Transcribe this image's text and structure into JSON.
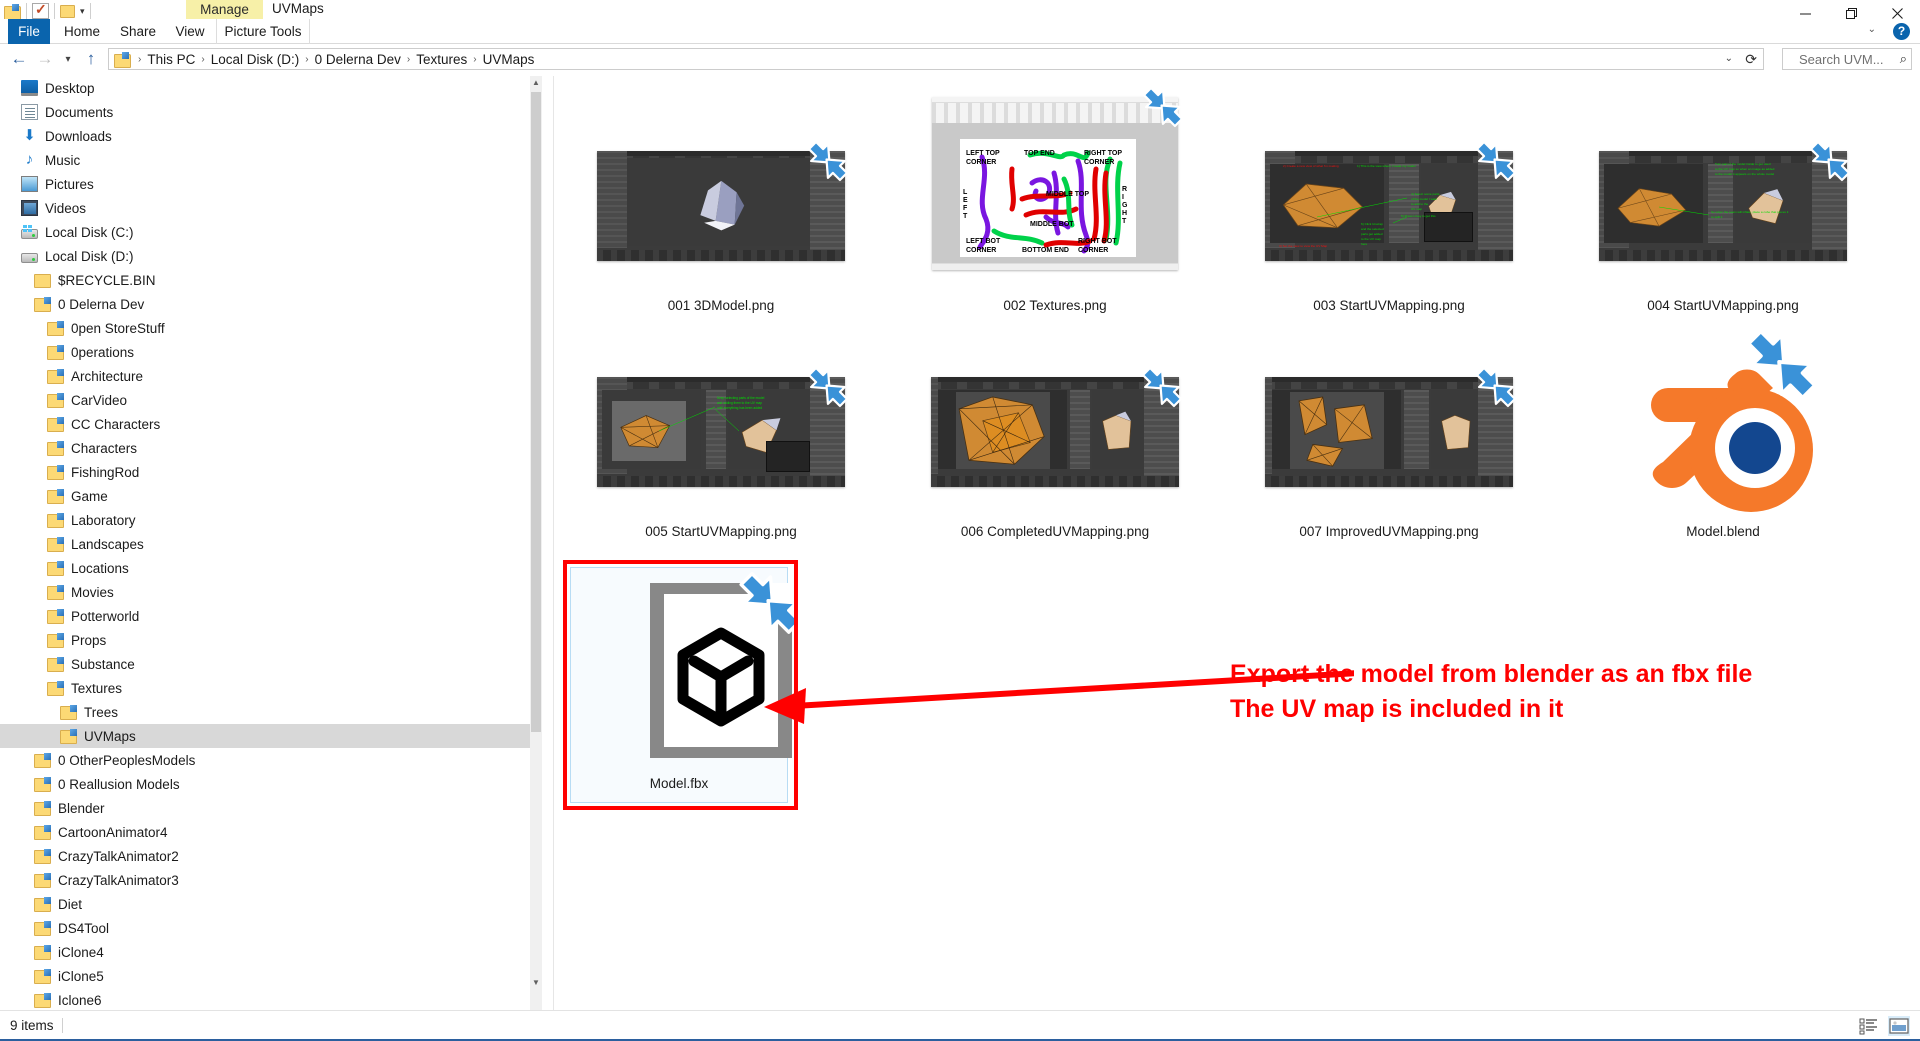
{
  "window": {
    "title": "UVMaps",
    "contextual_tab_group": "Manage",
    "contextual_tab": "Picture Tools",
    "minimize_label": "Minimize",
    "maximize_label": "Maximize",
    "close_label": "Close",
    "help_label": "?",
    "ribbon_collapse_label": "Collapse the Ribbon"
  },
  "quick_access": {
    "items": [
      {
        "name": "folder-properties-icon",
        "label": ""
      },
      {
        "name": "check-document-icon",
        "label": ""
      },
      {
        "name": "new-folder-icon",
        "label": ""
      },
      {
        "name": "customize-quick-access-chevron",
        "label": ""
      }
    ]
  },
  "ribbon": {
    "tabs": [
      {
        "id": "file",
        "label": "File"
      },
      {
        "id": "home",
        "label": "Home"
      },
      {
        "id": "share",
        "label": "Share"
      },
      {
        "id": "view",
        "label": "View"
      },
      {
        "id": "picture-tools",
        "label": "Picture Tools"
      }
    ]
  },
  "address": {
    "back_label": "Back",
    "forward_label": "Forward",
    "recent_label": "Recent locations",
    "up_label": "Up",
    "crumbs": [
      "This PC",
      "Local Disk (D:)",
      "0 Delerna Dev",
      "Textures",
      "UVMaps"
    ],
    "separator": "›",
    "dropdown_label": "Previous locations",
    "refresh_label": "Refresh"
  },
  "search": {
    "placeholder": "Search UVM...",
    "icon": "search-icon"
  },
  "nav_pane": {
    "items": [
      {
        "label": "Desktop",
        "icon": "desktop-icon",
        "indent": 1,
        "selected": false
      },
      {
        "label": "Documents",
        "icon": "documents-icon",
        "indent": 1,
        "selected": false
      },
      {
        "label": "Downloads",
        "icon": "downloads-icon",
        "indent": 1,
        "selected": false
      },
      {
        "label": "Music",
        "icon": "music-icon",
        "indent": 1,
        "selected": false
      },
      {
        "label": "Pictures",
        "icon": "pictures-icon",
        "indent": 1,
        "selected": false
      },
      {
        "label": "Videos",
        "icon": "videos-icon",
        "indent": 1,
        "selected": false
      },
      {
        "label": "Local Disk (C:)",
        "icon": "drive-windows-icon",
        "indent": 1,
        "selected": false
      },
      {
        "label": "Local Disk (D:)",
        "icon": "drive-icon",
        "indent": 1,
        "selected": false
      },
      {
        "label": "$RECYCLE.BIN",
        "icon": "folder-icon",
        "indent": 2,
        "selected": false
      },
      {
        "label": "0 Delerna Dev",
        "icon": "folder-shared-icon",
        "indent": 2,
        "selected": false
      },
      {
        "label": "0pen StoreStuff",
        "icon": "folder-shared-icon",
        "indent": 3,
        "selected": false
      },
      {
        "label": "0perations",
        "icon": "folder-shared-icon",
        "indent": 3,
        "selected": false
      },
      {
        "label": "Architecture",
        "icon": "folder-shared-icon",
        "indent": 3,
        "selected": false
      },
      {
        "label": "CarVideo",
        "icon": "folder-shared-icon",
        "indent": 3,
        "selected": false
      },
      {
        "label": "CC Characters",
        "icon": "folder-shared-icon",
        "indent": 3,
        "selected": false
      },
      {
        "label": "Characters",
        "icon": "folder-shared-icon",
        "indent": 3,
        "selected": false
      },
      {
        "label": "FishingRod",
        "icon": "folder-shared-icon",
        "indent": 3,
        "selected": false
      },
      {
        "label": "Game",
        "icon": "folder-shared-icon",
        "indent": 3,
        "selected": false
      },
      {
        "label": "Laboratory",
        "icon": "folder-shared-icon",
        "indent": 3,
        "selected": false
      },
      {
        "label": "Landscapes",
        "icon": "folder-shared-icon",
        "indent": 3,
        "selected": false
      },
      {
        "label": "Locations",
        "icon": "folder-shared-icon",
        "indent": 3,
        "selected": false
      },
      {
        "label": "Movies",
        "icon": "folder-shared-icon",
        "indent": 3,
        "selected": false
      },
      {
        "label": "Potterworld",
        "icon": "folder-shared-icon",
        "indent": 3,
        "selected": false
      },
      {
        "label": "Props",
        "icon": "folder-shared-icon",
        "indent": 3,
        "selected": false
      },
      {
        "label": "Substance",
        "icon": "folder-shared-icon",
        "indent": 3,
        "selected": false
      },
      {
        "label": "Textures",
        "icon": "folder-shared-icon",
        "indent": 3,
        "selected": false
      },
      {
        "label": "Trees",
        "icon": "folder-shared-icon",
        "indent": 4,
        "selected": false
      },
      {
        "label": "UVMaps",
        "icon": "folder-shared-icon",
        "indent": 4,
        "selected": true
      },
      {
        "label": "0 OtherPeoplesModels",
        "icon": "folder-shared-icon",
        "indent": 2,
        "selected": false
      },
      {
        "label": "0 Reallusion Models",
        "icon": "folder-shared-icon",
        "indent": 2,
        "selected": false
      },
      {
        "label": "Blender",
        "icon": "folder-shared-icon",
        "indent": 2,
        "selected": false
      },
      {
        "label": "CartoonAnimator4",
        "icon": "folder-shared-icon",
        "indent": 2,
        "selected": false
      },
      {
        "label": "CrazyTalkAnimator2",
        "icon": "folder-shared-icon",
        "indent": 2,
        "selected": false
      },
      {
        "label": "CrazyTalkAnimator3",
        "icon": "folder-shared-icon",
        "indent": 2,
        "selected": false
      },
      {
        "label": "Diet",
        "icon": "folder-shared-icon",
        "indent": 2,
        "selected": false
      },
      {
        "label": "DS4Tool",
        "icon": "folder-shared-icon",
        "indent": 2,
        "selected": false
      },
      {
        "label": "iClone4",
        "icon": "folder-shared-icon",
        "indent": 2,
        "selected": false
      },
      {
        "label": "iClone5",
        "icon": "folder-shared-icon",
        "indent": 2,
        "selected": false
      },
      {
        "label": "Iclone6",
        "icon": "folder-shared-icon",
        "indent": 2,
        "selected": false
      }
    ]
  },
  "files": [
    {
      "name": "001 3DModel.png",
      "kind": "blender-viewport",
      "shortcut": true,
      "selected": false
    },
    {
      "name": "002 Textures.png",
      "kind": "paint-texture",
      "shortcut": true,
      "selected": false
    },
    {
      "name": "003 StartUVMapping.png",
      "kind": "blender-uv-notes",
      "shortcut": true,
      "selected": false
    },
    {
      "name": "004 StartUVMapping.png",
      "kind": "blender-uv-notes2",
      "shortcut": true,
      "selected": false
    },
    {
      "name": "005 StartUVMapping.png",
      "kind": "blender-uv-notes3",
      "shortcut": true,
      "selected": false
    },
    {
      "name": "006 CompletedUVMapping.png",
      "kind": "blender-uv-full",
      "shortcut": true,
      "selected": false
    },
    {
      "name": "007 ImprovedUVMapping.png",
      "kind": "blender-uv-split",
      "shortcut": true,
      "selected": false
    },
    {
      "name": "Model.blend",
      "kind": "blender-logo",
      "shortcut": true,
      "selected": false
    },
    {
      "name": "Model.fbx",
      "kind": "fbx-document",
      "shortcut": true,
      "selected": true
    }
  ],
  "texture_thumbnail_labels": {
    "left_top_corner": "LEFT TOP\nCORNER",
    "top_end": "TOP END",
    "right_top_corner": "RIGHT TOP\nCORNER",
    "middle_top": "MIDDLE TOP",
    "middle_bot": "MIDDLE BOT",
    "left_end": "LEFT END",
    "right_end": "RIGHT END",
    "left_bot_corner": "LEFT BOT\nCORNER",
    "bottom_end": "BOTTOM END",
    "right_bot_corner": "RIGHT BOT\nCORNER"
  },
  "annotation": {
    "line1": "Export the model from blender as an fbx file",
    "line2": "The UV map is included in it",
    "color": "#ff0000"
  },
  "status_bar": {
    "item_count": "9 items",
    "view_large_icons_label": "Large icons",
    "view_details_label": "Details"
  },
  "colors": {
    "file_tab": "#0a64ad",
    "contextual_group": "#f7f0a8",
    "selection": "#d8d8d8",
    "accent_blue": "#2b5f9e",
    "blender_orange": "#f5792a",
    "blender_blue": "#13478f",
    "shortcut_blue": "#3a92d8",
    "annotation_red": "#ff0000"
  }
}
